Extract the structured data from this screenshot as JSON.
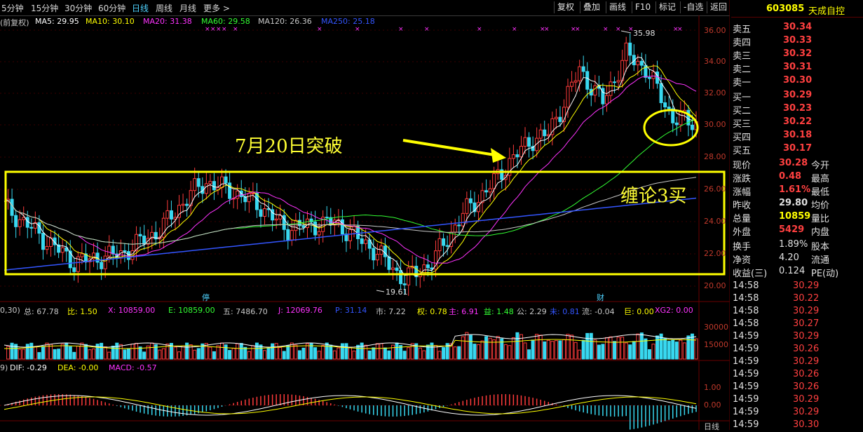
{
  "toolbar": {
    "periods": [
      "5分钟",
      "15分钟",
      "30分钟",
      "60分钟",
      "日线",
      "周线",
      "月线",
      "更多 >"
    ],
    "active_period": "日线",
    "buttons": [
      "复权",
      "叠加",
      "画线",
      "F10",
      "标记",
      "-自选",
      "返回"
    ]
  },
  "ma_legend": {
    "prefix": "(前复权)",
    "ma5": "MA5: 29.95",
    "ma10": "MA10: 30.10",
    "ma20": "MA20: 31.38",
    "ma60": "MA60: 29.58",
    "ma120": "MA120: 26.36",
    "ma250": "MA250: 25.18",
    "colors": {
      "ma5": "#ffffff",
      "ma10": "#ffff00",
      "ma20": "#ff33ff",
      "ma60": "#33ff33",
      "ma120": "#c8c8c8",
      "ma250": "#3355ff"
    }
  },
  "price_axis": [
    "36.00",
    "34.00",
    "32.00",
    "30.00",
    "28.00",
    "26.00",
    "24.00",
    "22.00",
    "20.00"
  ],
  "annotations": {
    "high_marker": "35.98",
    "low_marker": "19.61",
    "breakout_text": "7月20日突破",
    "chan_text": "缠论3买",
    "event_markers": [
      "停",
      "财"
    ]
  },
  "indicator_1": {
    "prefix": "0,30)",
    "items": [
      "总: 67.78",
      "比: 1.50",
      "X: 10859.00",
      "E: 10859.00",
      "五: 7486.70",
      "J: 12069.76",
      "P: 31.14",
      "市: 7.22",
      "权: 0.78",
      "主: 6.91",
      "益: 1.48",
      "公: 2.29",
      "未: 0.81",
      "流: -0.04",
      "巨: 0.00",
      "XG2: 0.00"
    ],
    "axis": [
      "30000",
      "15000"
    ]
  },
  "indicator_2": {
    "prefix": "9)",
    "dif": "DIF: -0.29",
    "dea": "DEA: -0.00",
    "macd": "MACD: -0.57",
    "axis": [
      "1.00",
      "0.00"
    ],
    "bottom_label": "日线"
  },
  "quote": {
    "code": "603085",
    "name": "天成自控",
    "asks": [
      {
        "label": "卖五",
        "price": "30.34"
      },
      {
        "label": "卖四",
        "price": "30.33"
      },
      {
        "label": "卖三",
        "price": "30.32"
      },
      {
        "label": "卖二",
        "price": "30.31"
      },
      {
        "label": "卖一",
        "price": "30.30"
      }
    ],
    "bids": [
      {
        "label": "买一",
        "price": "30.29"
      },
      {
        "label": "买二",
        "price": "30.23"
      },
      {
        "label": "买三",
        "price": "30.22"
      },
      {
        "label": "买四",
        "price": "30.18"
      },
      {
        "label": "买五",
        "price": "30.17"
      }
    ],
    "stats": [
      {
        "l": "现价",
        "v": "30.28",
        "l2": "今开"
      },
      {
        "l": "涨跌",
        "v": "0.48",
        "l2": "最高"
      },
      {
        "l": "涨幅",
        "v": "1.61%",
        "l2": "最低"
      },
      {
        "l": "昨收",
        "v": "29.80",
        "l2": "均价"
      },
      {
        "l": "总量",
        "v": "10859",
        "l2": "量比"
      },
      {
        "l": "外盘",
        "v": "5429",
        "l2": "内盘"
      }
    ],
    "stats2": [
      {
        "l": "换手",
        "v": "1.89%",
        "l2": "股本"
      },
      {
        "l": "净资",
        "v": "4.20",
        "l2": "流通"
      },
      {
        "l": "收益(三)",
        "v": "0.124",
        "l2": "PE(动)"
      }
    ],
    "ticks": [
      {
        "t": "14:58",
        "p": "30.29"
      },
      {
        "t": "14:58",
        "p": "30.22"
      },
      {
        "t": "14:58",
        "p": "30.29"
      },
      {
        "t": "14:58",
        "p": "30.27"
      },
      {
        "t": "14:59",
        "p": "30.29"
      },
      {
        "t": "14:59",
        "p": "30.26"
      },
      {
        "t": "14:59",
        "p": "30.29"
      },
      {
        "t": "14:59",
        "p": "30.26"
      },
      {
        "t": "14:59",
        "p": "30.26"
      },
      {
        "t": "14:59",
        "p": "30.29"
      },
      {
        "t": "14:59",
        "p": "30.29"
      },
      {
        "t": "14:59",
        "p": "30.30"
      }
    ]
  }
}
